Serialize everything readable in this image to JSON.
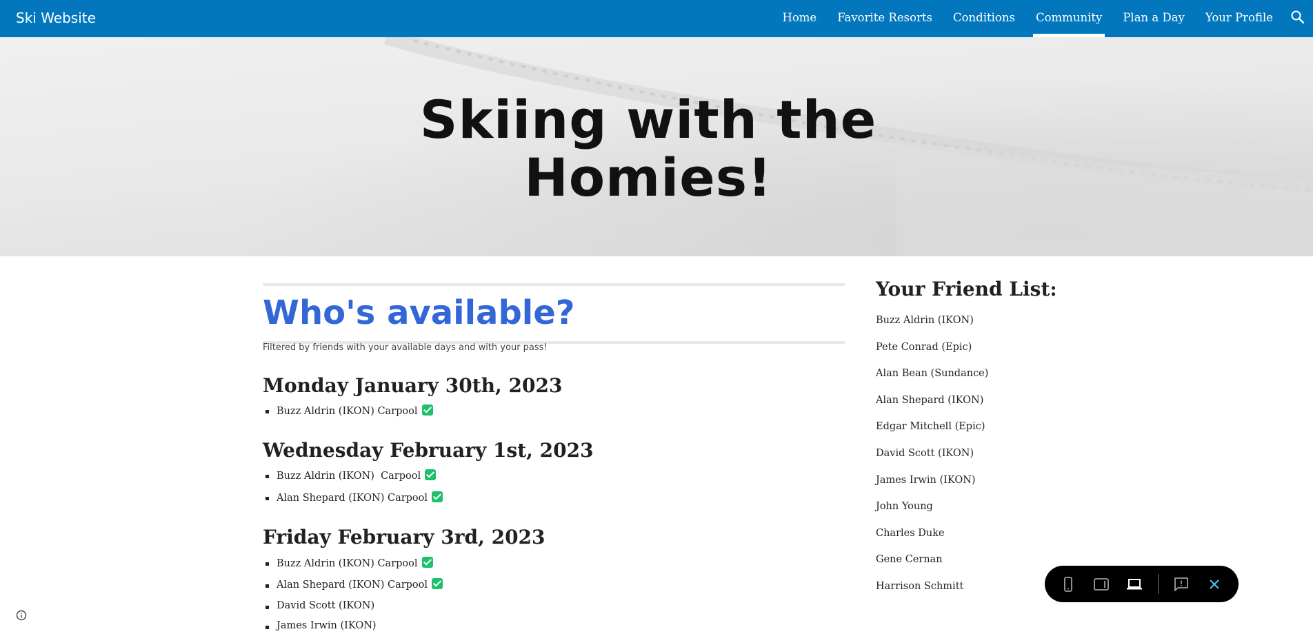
{
  "header": {
    "site_title": "Ski Website",
    "nav": [
      {
        "label": "Home",
        "active": false
      },
      {
        "label": "Favorite Resorts",
        "active": false
      },
      {
        "label": "Conditions",
        "active": false
      },
      {
        "label": "Community",
        "active": true
      },
      {
        "label": "Plan a Day",
        "active": false
      },
      {
        "label": "Your Profile",
        "active": false
      }
    ],
    "search_icon": "search-icon"
  },
  "hero": {
    "title_line1": "Skiing with the",
    "title_line2": "Homies!"
  },
  "main": {
    "title": "Who's available?",
    "subtitle": "Filtered by friends with your available days and with your pass!",
    "days": [
      {
        "date": "Monday January 30th, 2023",
        "people": [
          {
            "text": "Buzz Aldrin (IKON) Carpool",
            "carpool_check": true
          }
        ]
      },
      {
        "date": "Wednesday February 1st, 2023",
        "people": [
          {
            "text": "Buzz Aldrin (IKON)  Carpool",
            "carpool_check": true
          },
          {
            "text": "Alan Shepard (IKON) Carpool",
            "carpool_check": true
          }
        ]
      },
      {
        "date": "Friday February 3rd, 2023",
        "people": [
          {
            "text": "Buzz Aldrin (IKON) Carpool",
            "carpool_check": true
          },
          {
            "text": "Alan Shepard (IKON) Carpool",
            "carpool_check": true
          },
          {
            "text": "David Scott (IKON)",
            "carpool_check": false
          },
          {
            "text": "James Irwin (IKON)",
            "carpool_check": false
          }
        ]
      }
    ]
  },
  "sidebar": {
    "title": "Your Friend List:",
    "friends": [
      "Buzz Aldrin (IKON)",
      "Pete Conrad (Epic)",
      "Alan Bean (Sundance)",
      "Alan Shepard (IKON)",
      "Edgar Mitchell (Epic)",
      "David Scott (IKON)",
      "James Irwin (IKON)",
      "John Young",
      "Charles Duke",
      "Gene Cernan",
      "Harrison Schmitt"
    ]
  },
  "preview_toolbar": {
    "icons": [
      "phone-icon",
      "tablet-icon",
      "laptop-icon",
      "report-issue-icon",
      "close-icon"
    ],
    "active": "laptop-icon",
    "close_color": "#4fc3f7"
  },
  "footer": {
    "info_icon": "info-icon"
  },
  "colors": {
    "header": "#0277bd",
    "accent_title": "#3367d6",
    "check": "#1fc06d"
  }
}
